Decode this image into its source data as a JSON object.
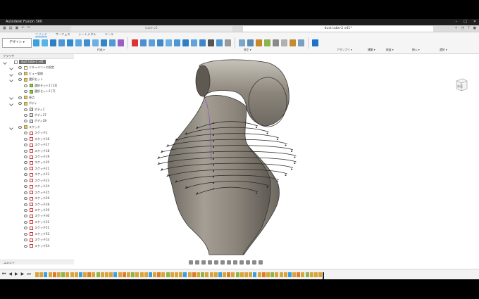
{
  "window": {
    "title": "Autodesk Fusion 360"
  },
  "tabs": [
    {
      "label": "tube v2",
      "active": false
    },
    {
      "label": "duct tube-2 v41*",
      "active": true
    }
  ],
  "ribbon": {
    "tabs": [
      "ソリッド",
      "サーフェス",
      "シートメタル",
      "ツール"
    ],
    "workspace": "デザイン ▾",
    "groups": [
      "作成 ▾",
      "修正 ▾",
      "アセンブリ ▾",
      "構築 ▾",
      "検査 ▾",
      "挿入 ▾",
      "選択 ▾"
    ]
  },
  "browser": {
    "title": "ブラウザ",
    "root": "duct tube-2 v41",
    "items": [
      {
        "label": "ドキュメントの設定",
        "level": 1,
        "icon": "doc"
      },
      {
        "label": "ビュー管理",
        "level": 1,
        "icon": "folder"
      },
      {
        "label": "選択セット",
        "level": 1,
        "icon": "folder"
      },
      {
        "label": "選択セット1 [13]",
        "level": 2,
        "icon": "sel"
      },
      {
        "label": "選択セット2 [7]",
        "level": 2,
        "icon": "sel"
      },
      {
        "label": "原点",
        "level": 1,
        "icon": "folder"
      },
      {
        "label": "ボディ",
        "level": 1,
        "icon": "folder"
      },
      {
        "label": "ボディ1",
        "level": 2,
        "icon": "body"
      },
      {
        "label": "ボディ27",
        "level": 2,
        "icon": "body"
      },
      {
        "label": "ボディ28",
        "level": 2,
        "icon": "body"
      },
      {
        "label": "スケッチ",
        "level": 1,
        "icon": "folder"
      },
      {
        "label": "スケッチ1",
        "level": 2,
        "icon": "sketch"
      },
      {
        "label": "スケッチ16",
        "level": 2,
        "icon": "sketch"
      },
      {
        "label": "スケッチ17",
        "level": 2,
        "icon": "sketch"
      },
      {
        "label": "スケッチ18",
        "level": 2,
        "icon": "sketch"
      },
      {
        "label": "スケッチ19",
        "level": 2,
        "icon": "sketch"
      },
      {
        "label": "スケッチ20",
        "level": 2,
        "icon": "sketch"
      },
      {
        "label": "スケッチ21",
        "level": 2,
        "icon": "sketch"
      },
      {
        "label": "スケッチ22",
        "level": 2,
        "icon": "sketch"
      },
      {
        "label": "スケッチ23",
        "level": 2,
        "icon": "sketch"
      },
      {
        "label": "スケッチ24",
        "level": 2,
        "icon": "sketch"
      },
      {
        "label": "スケッチ25",
        "level": 2,
        "icon": "sketch"
      },
      {
        "label": "スケッチ26",
        "level": 2,
        "icon": "sketch"
      },
      {
        "label": "スケッチ28",
        "level": 2,
        "icon": "sketch"
      },
      {
        "label": "スケッチ29",
        "level": 2,
        "icon": "sketch"
      },
      {
        "label": "スケッチ30",
        "level": 2,
        "icon": "sketch"
      },
      {
        "label": "スケッチ31",
        "level": 2,
        "icon": "sketch"
      },
      {
        "label": "スケッチ51",
        "level": 2,
        "icon": "sketch"
      },
      {
        "label": "スケッチ52",
        "level": 2,
        "icon": "sketch"
      },
      {
        "label": "スケッチ53",
        "level": 2,
        "icon": "sketch"
      },
      {
        "label": "スケッチ54",
        "level": 2,
        "icon": "sketch"
      }
    ]
  },
  "comments": {
    "label": "コメント"
  },
  "viewcube": {
    "face": "前面"
  },
  "colors": {
    "accent": "#1b74c9",
    "body": "#8f887e",
    "sketch": "#7b3fc4"
  }
}
